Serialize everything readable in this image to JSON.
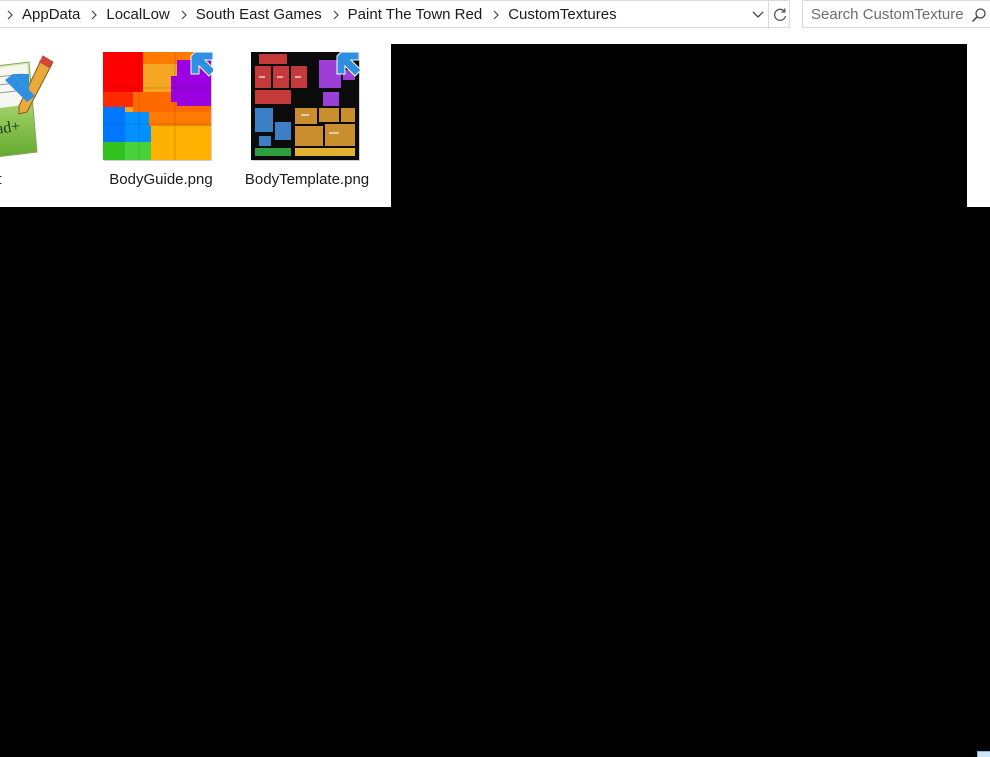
{
  "breadcrumb": {
    "items": [
      {
        "label": "AppData"
      },
      {
        "label": "LocalLow"
      },
      {
        "label": "South East Games"
      },
      {
        "label": "Paint The Town Red"
      },
      {
        "label": "CustomTextures"
      }
    ]
  },
  "search": {
    "placeholder": "Search CustomTextures",
    "value": ""
  },
  "files": [
    {
      "name": "adme.txt",
      "icon": "notepad-plus-plus-icon"
    },
    {
      "name": "BodyGuide.png",
      "icon": "image-thumbnail"
    },
    {
      "name": "BodyTemplate.png",
      "icon": "image-thumbnail"
    }
  ],
  "colors": {
    "overlay": "#000000",
    "shortcut_arrow": "#2f8fe0",
    "accent_hover": "#e5f3ff"
  }
}
